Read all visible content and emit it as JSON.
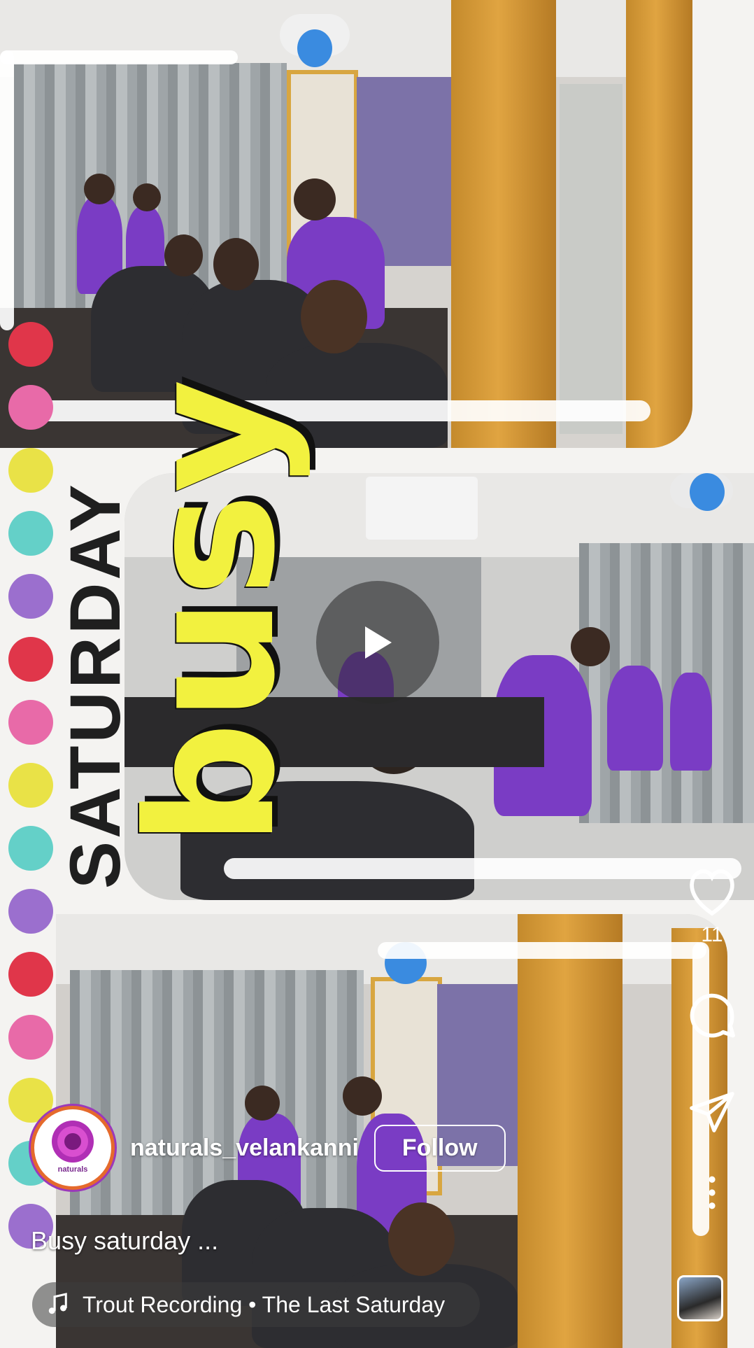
{
  "post": {
    "text_overlay_top": "SATURDAY",
    "text_overlay_big": "busy"
  },
  "colors": {
    "dots": [
      "#e0364a",
      "#e86aa8",
      "#e9e247",
      "#64d0c8",
      "#9b6fce",
      "#e0364a",
      "#e86aa8",
      "#e9e247",
      "#64d0c8",
      "#9b6fce",
      "#e0364a",
      "#e86aa8",
      "#e9e247",
      "#64d0c8",
      "#9b6fce"
    ],
    "uniform_purple": "#7a3cc4",
    "busy_yellow": "#f2f13f"
  },
  "actions": {
    "like_icon": "heart-icon",
    "like_count": "11",
    "comment_icon": "comment-icon",
    "share_icon": "send-icon",
    "more_icon": "more-vertical-icon"
  },
  "owner": {
    "username": "naturals_velankanni",
    "follow_label": "Follow",
    "logo_text": "naturals"
  },
  "caption": "Busy saturday ...",
  "audio": {
    "icon": "music-note-icon",
    "label": "Trout Recording • The Last Saturday"
  },
  "playback": {
    "icon": "play-icon"
  }
}
